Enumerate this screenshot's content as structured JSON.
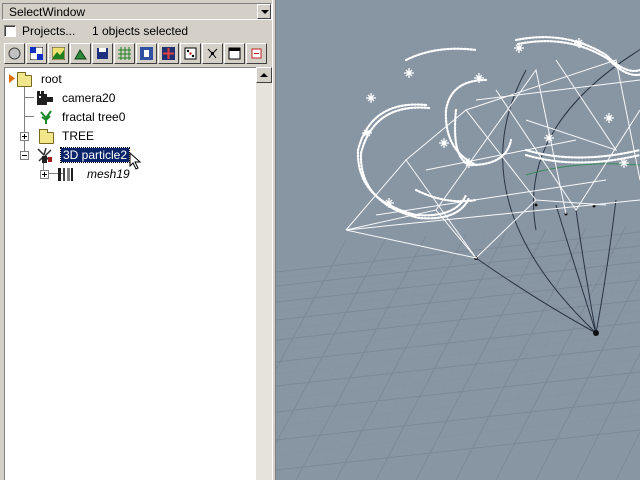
{
  "window": {
    "title": "SelectWindow"
  },
  "projects": {
    "label": "Projects...",
    "checked": false,
    "selected_count_text": "1 objects selected"
  },
  "toolbar": {
    "buttons": [
      "circle-icon",
      "checker-icon",
      "image-icon",
      "terrain-icon",
      "disk-icon",
      "grid-icon",
      "film-icon",
      "target-icon",
      "dice-icon",
      "node-graph-icon",
      "window-icon",
      "link-icon"
    ]
  },
  "tree": {
    "root": "root",
    "items": [
      {
        "label": "camera20",
        "icon": "camera-icon"
      },
      {
        "label": "fractal tree0",
        "icon": "plant-icon"
      },
      {
        "label": "TREE",
        "icon": "folder-icon"
      },
      {
        "label": "3D particle2",
        "icon": "particle-icon",
        "selected": true
      },
      {
        "label": "mesh19",
        "icon": "mesh-icon",
        "italic": true
      }
    ]
  },
  "colors": {
    "ui_face": "#d4d0c8",
    "selection": "#0a246a",
    "viewport_bg": "#8896a4",
    "grid_line": "#7e8b98"
  }
}
